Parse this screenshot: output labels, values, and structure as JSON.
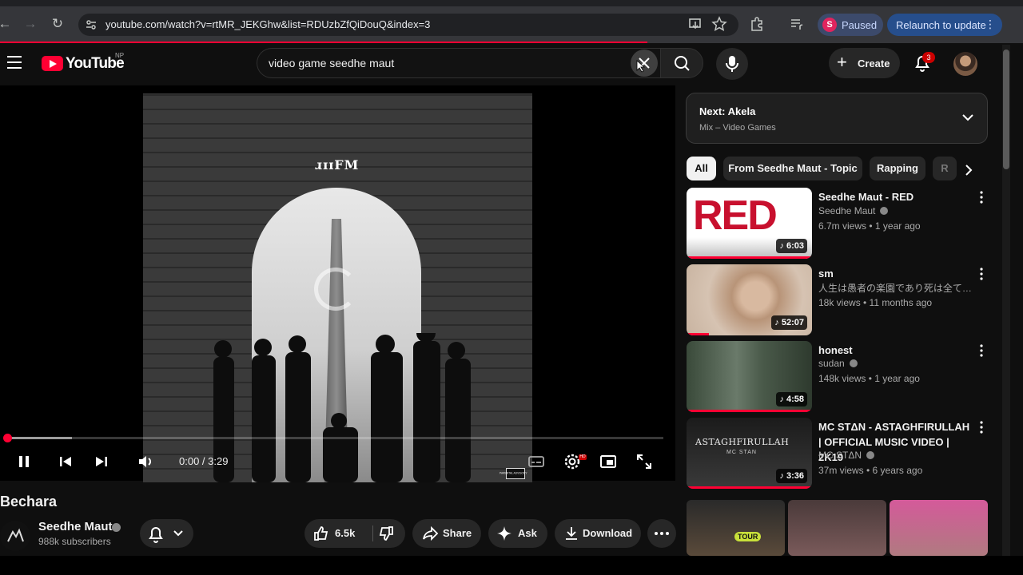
{
  "browser": {
    "url": "youtube.com/watch?v=rtMR_JEKGhw&list=RDUzbZfQiDouQ&index=3",
    "profile_initial": "S",
    "profile_status": "Paused",
    "relaunch_label": "Relaunch to update"
  },
  "masthead": {
    "logo_text": "YouTube",
    "country_code": "NP",
    "search_query": "video game seedhe maut",
    "create_label": "Create",
    "notification_count": "3"
  },
  "player": {
    "cover_logo_text": "ɹɪɪFM",
    "current_time": "0:00 / 3:29",
    "progress_fraction": 0.0,
    "explicit_label": "PARENTAL ADVISORY"
  },
  "video": {
    "title": "Bechara",
    "channel_name": "Seedhe Maut",
    "subscribers": "988k subscribers",
    "like_count": "6.5k",
    "share_label": "Share",
    "ask_label": "Ask",
    "download_label": "Download"
  },
  "sidebar": {
    "next_title": "Next: Akela",
    "next_subtitle": "Mix – Video Games",
    "chips": [
      {
        "label": "All"
      },
      {
        "label": "From Seedhe Maut - Topic"
      },
      {
        "label": "Rapping"
      },
      {
        "label": "R"
      }
    ],
    "recommendations": [
      {
        "title": "Seedhe Maut - RED",
        "channel": "Seedhe Maut",
        "meta": "6.7m views • 1 year ago",
        "duration": "6:03",
        "watched": 1.0
      },
      {
        "title": "sm",
        "channel": "人生は愚者の楽園であり死は全ての幻...",
        "meta": "18k views • 11 months ago",
        "duration": "52:07",
        "watched": 0.18
      },
      {
        "title": "honest",
        "channel": "sudan",
        "meta": "148k views • 1 year ago",
        "duration": "4:58",
        "watched": 1.0
      },
      {
        "title": "MC STΔN - ASTAGHFIRULLAH | OFFICIAL MUSIC VIDEO | 2K19",
        "channel": "MC STΔN",
        "meta": "37m views • 6 years ago",
        "duration": "3:36",
        "watched": 1.0
      }
    ],
    "thumb_texts": {
      "red": "RED",
      "astag_title": "ASTAGHFIRULLAH",
      "astag_sub": "MC STAN",
      "short_1": "TOUR"
    }
  },
  "colors": {
    "accent": "#ff0033",
    "background": "#0f0f0f",
    "pill": "#272727"
  }
}
